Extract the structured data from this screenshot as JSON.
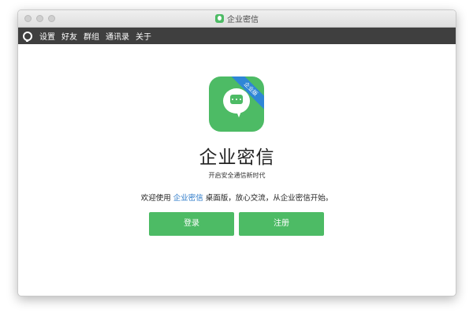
{
  "window": {
    "title": "企业密信"
  },
  "menubar": {
    "items": [
      {
        "label": "设置"
      },
      {
        "label": "好友"
      },
      {
        "label": "群组"
      },
      {
        "label": "通讯录"
      },
      {
        "label": "关于"
      }
    ]
  },
  "main": {
    "badge": "企业版",
    "app_name": "企业密信",
    "tagline": "开启安全通信新时代",
    "welcome_prefix": "欢迎使用 ",
    "welcome_link": "企业密信",
    "welcome_suffix": " 桌面版，放心交流，从企业密信开始。",
    "login_label": "登录",
    "register_label": "注册"
  },
  "colors": {
    "accent": "#4dbb65",
    "menubar": "#3f3f3f",
    "link": "#2a78c8",
    "badge": "#2f86d6"
  }
}
